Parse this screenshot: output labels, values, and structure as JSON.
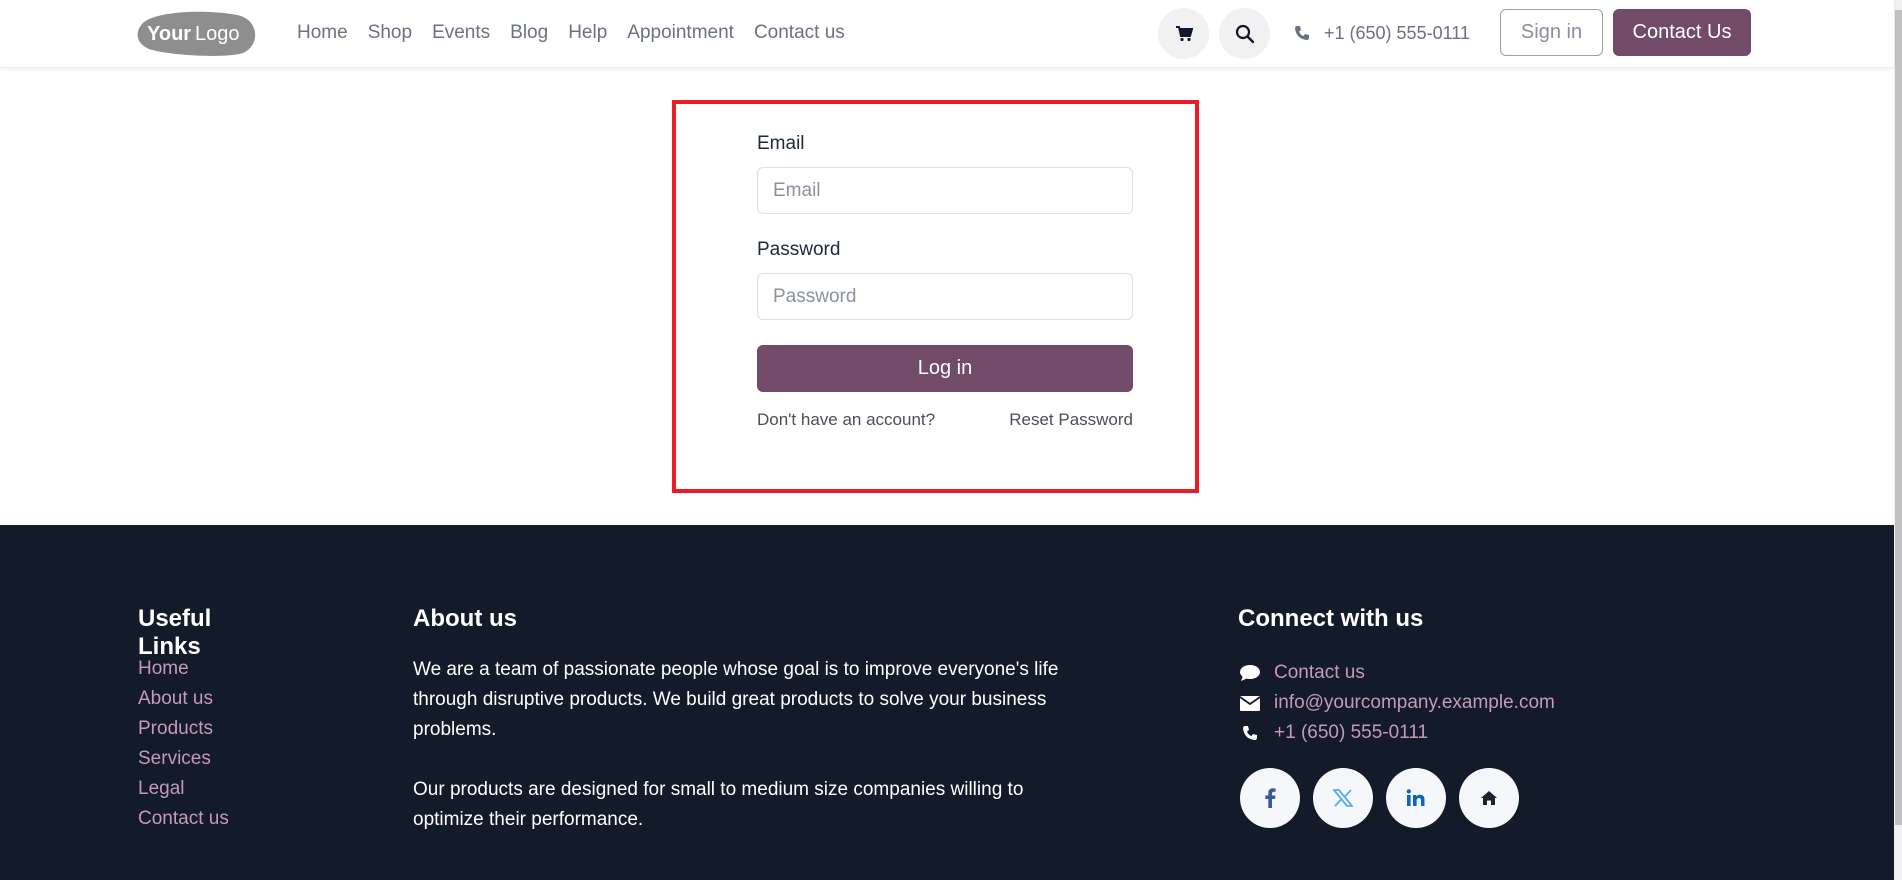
{
  "navbar": {
    "logo": {
      "bold": "Your",
      "light": "Logo"
    },
    "links": [
      "Home",
      "Shop",
      "Events",
      "Blog",
      "Help",
      "Appointment",
      "Contact us"
    ],
    "cart_icon": "cart-icon",
    "search_icon": "search-icon",
    "phone": "+1 (650) 555-0111",
    "sign_in": "Sign in",
    "contact_button": "Contact Us"
  },
  "login": {
    "email_label": "Email",
    "email_placeholder": "Email",
    "email_value": "",
    "password_label": "Password",
    "password_placeholder": "Password",
    "password_value": "",
    "submit": "Log in",
    "signup_link": "Don't have an account?",
    "reset_link": "Reset Password"
  },
  "footer": {
    "useful_links": {
      "title": "Useful Links",
      "items": [
        "Home",
        "About us",
        "Products",
        "Services",
        "Legal",
        "Contact us"
      ]
    },
    "about": {
      "title": "About us",
      "paragraphs": [
        "We are a team of passionate people whose goal is to improve everyone's life through disruptive products. We build great products to solve your business problems.",
        "Our products are designed for small to medium size companies willing to optimize their performance."
      ]
    },
    "connect": {
      "title": "Connect with us",
      "items": [
        {
          "icon": "comment-icon",
          "label": "Contact us"
        },
        {
          "icon": "envelope-icon",
          "label": "info@yourcompany.example.com"
        },
        {
          "icon": "phone-icon",
          "label": "+1 (650) 555-0111"
        }
      ],
      "socials": [
        "facebook-icon",
        "x-twitter-icon",
        "linkedin-icon",
        "home-icon"
      ]
    }
  },
  "colors": {
    "brand": "#714b67",
    "footer_bg": "#131a29",
    "footer_link": "#c49ab8",
    "highlight": "#ec1c24"
  }
}
